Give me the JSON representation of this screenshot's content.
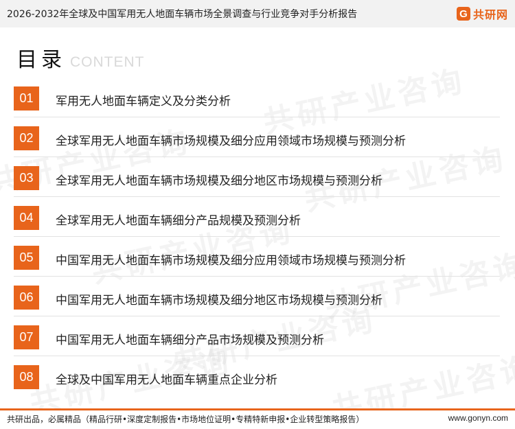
{
  "header": {
    "title": "2026-2032年全球及中国军用无人地面车辆市场全景调查与行业竞争对手分析报告",
    "logo_mark": "G",
    "logo_text": "共研网",
    "accent": "#e8641b"
  },
  "toc": {
    "title": "目录",
    "subtitle": "CONTENT",
    "items": [
      {
        "number": "01",
        "label": "军用无人地面车辆定义及分类分析"
      },
      {
        "number": "02",
        "label": "全球军用无人地面车辆市场规模及细分应用领域市场规模与预测分析"
      },
      {
        "number": "03",
        "label": "全球军用无人地面车辆市场规模及细分地区市场规模与预测分析"
      },
      {
        "number": "04",
        "label": "全球军用无人地面车辆细分产品规模及预测分析"
      },
      {
        "number": "05",
        "label": "中国军用无人地面车辆市场规模及细分应用领域市场规模与预测分析"
      },
      {
        "number": "06",
        "label": "中国军用无人地面车辆市场规模及细分地区市场规模与预测分析"
      },
      {
        "number": "07",
        "label": "中国军用无人地面车辆细分产品市场规模及预测分析"
      },
      {
        "number": "08",
        "label": "全球及中国军用无人地面车辆重点企业分析"
      }
    ]
  },
  "watermark": {
    "text": "共研产业咨询"
  },
  "footer": {
    "left": "共研出品，必属精品（精品行研•深度定制报告•市场地位证明•专精特新申报•企业转型策略报告）",
    "right": "www.gonyn.com"
  }
}
